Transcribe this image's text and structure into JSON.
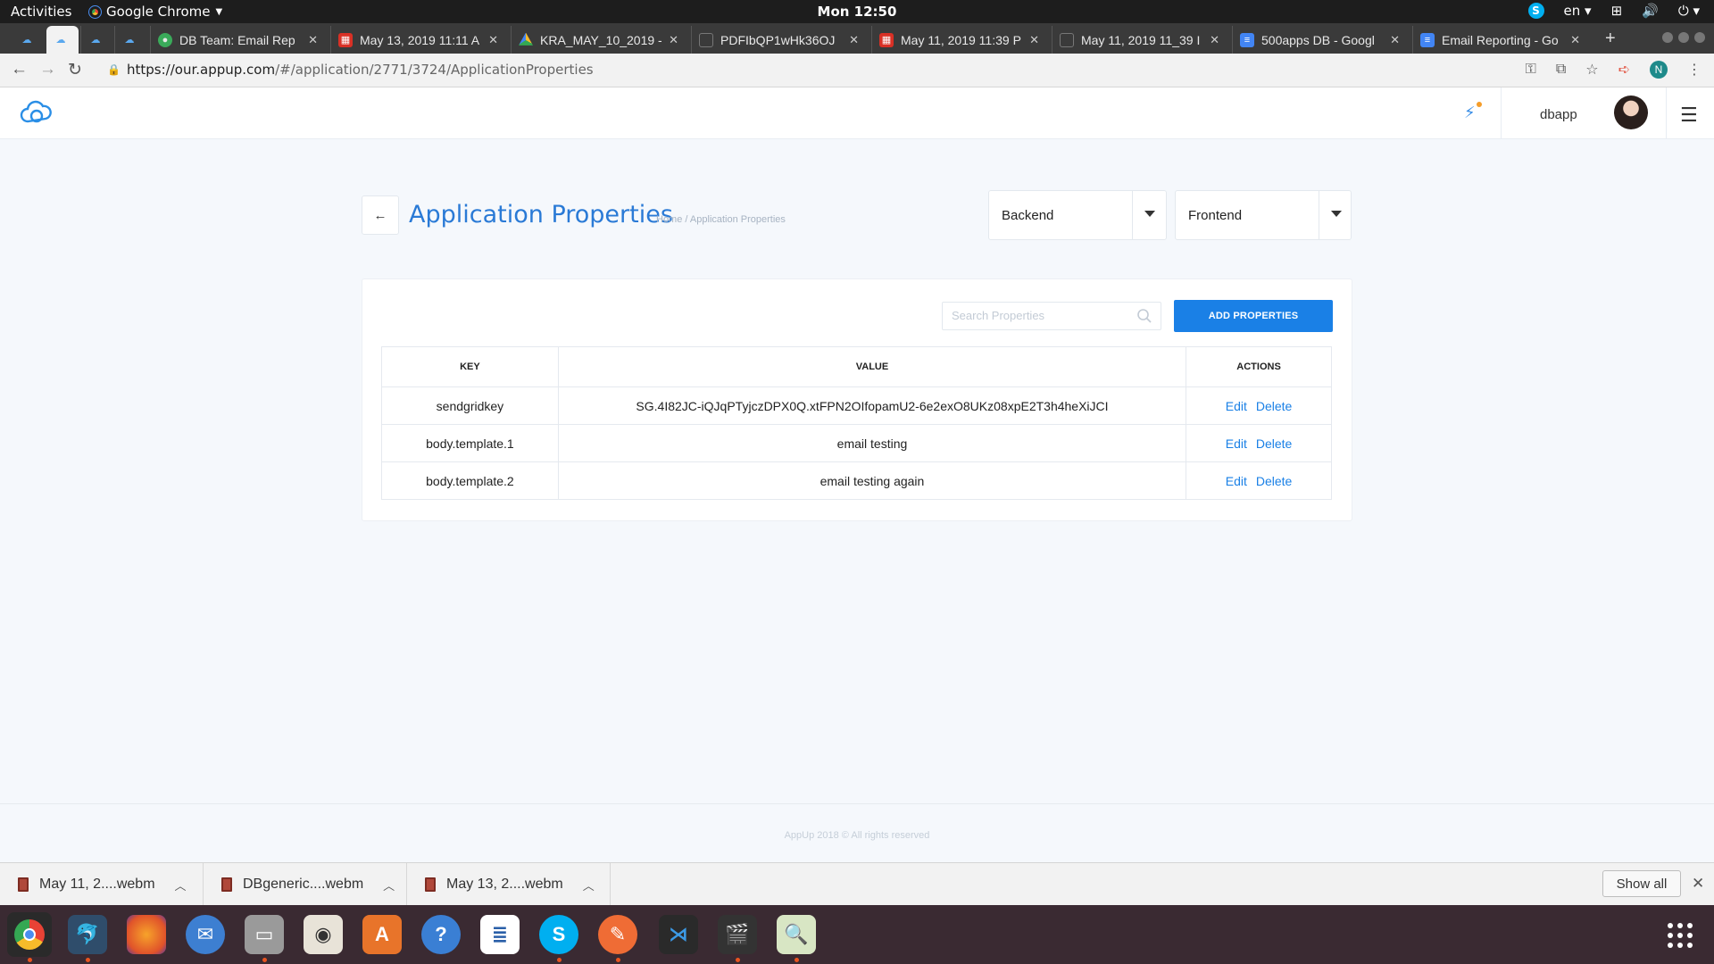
{
  "os": {
    "activities": "Activities",
    "app_name": "Google Chrome",
    "clock": "Mon 12:50",
    "keyboard_layout": "en"
  },
  "browser": {
    "tabs": [
      {
        "title": "",
        "icon": "appup-cloud-icon",
        "active": false
      },
      {
        "title": "",
        "icon": "appup-cloud-icon",
        "active": true
      },
      {
        "title": "",
        "icon": "appup-cloud-icon",
        "active": false
      },
      {
        "title": "",
        "icon": "appup-cloud-icon",
        "active": false
      },
      {
        "title": "DB Team: Email Rep",
        "icon": "db-team-icon",
        "active": false
      },
      {
        "title": "May 13, 2019 11:11 A",
        "icon": "calendar-icon",
        "active": false
      },
      {
        "title": "KRA_MAY_10_2019 -",
        "icon": "drive-icon",
        "active": false
      },
      {
        "title": "PDFIbQP1wHk36OJ",
        "icon": "file-icon",
        "active": false
      },
      {
        "title": "May 11, 2019 11:39 P",
        "icon": "calendar-icon",
        "active": false
      },
      {
        "title": "May 11, 2019 11_39 I",
        "icon": "file-icon",
        "active": false
      },
      {
        "title": "500apps DB - Googl",
        "icon": "docs-icon",
        "active": false
      },
      {
        "title": "Email Reporting - Go",
        "icon": "docs-icon",
        "active": false
      }
    ],
    "url_host": "https://our.appup.com",
    "url_path": "/#/application/2771/3724/ApplicationProperties",
    "profile_initial": "N"
  },
  "app": {
    "user_name": "dbapp",
    "page_title": "Application Properties",
    "breadcrumb_home": "Home",
    "breadcrumb_sep": "/",
    "breadcrumb_current": "Application Properties",
    "backend_select": "Backend",
    "frontend_select": "Frontend",
    "search_placeholder": "Search Properties",
    "add_button": "ADD PROPERTIES",
    "table": {
      "headers": {
        "key": "KEY",
        "value": "VALUE",
        "actions": "ACTIONS"
      },
      "rows": [
        {
          "key": "sendgridkey",
          "value": "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",
          "edit": "Edit",
          "delete": "Delete"
        },
        {
          "key": "body.template.1",
          "value": "email testing",
          "edit": "Edit",
          "delete": "Delete"
        },
        {
          "key": "body.template.2",
          "value": "email testing again",
          "edit": "Edit",
          "delete": "Delete"
        }
      ]
    },
    "footer": "AppUp 2018 © All rights reserved"
  },
  "downloads": {
    "items": [
      "May 11, 2....webm",
      "DBgeneric....webm",
      "May 13, 2....webm"
    ],
    "show_all": "Show all"
  },
  "dock": {
    "apps": [
      "chrome-icon",
      "mysql-workbench-icon",
      "firefox-icon",
      "thunderbird-icon",
      "files-icon",
      "rhythmbox-icon",
      "software-center-icon",
      "help-icon",
      "writer-icon",
      "skype-icon",
      "postman-icon",
      "vscode-icon",
      "video-editor-icon",
      "image-viewer-icon"
    ]
  },
  "colors": {
    "accent": "#1a80e6",
    "title": "#2a7ad6",
    "page_bg": "#f5f8fc",
    "dock_bg": "#3a2a32"
  }
}
